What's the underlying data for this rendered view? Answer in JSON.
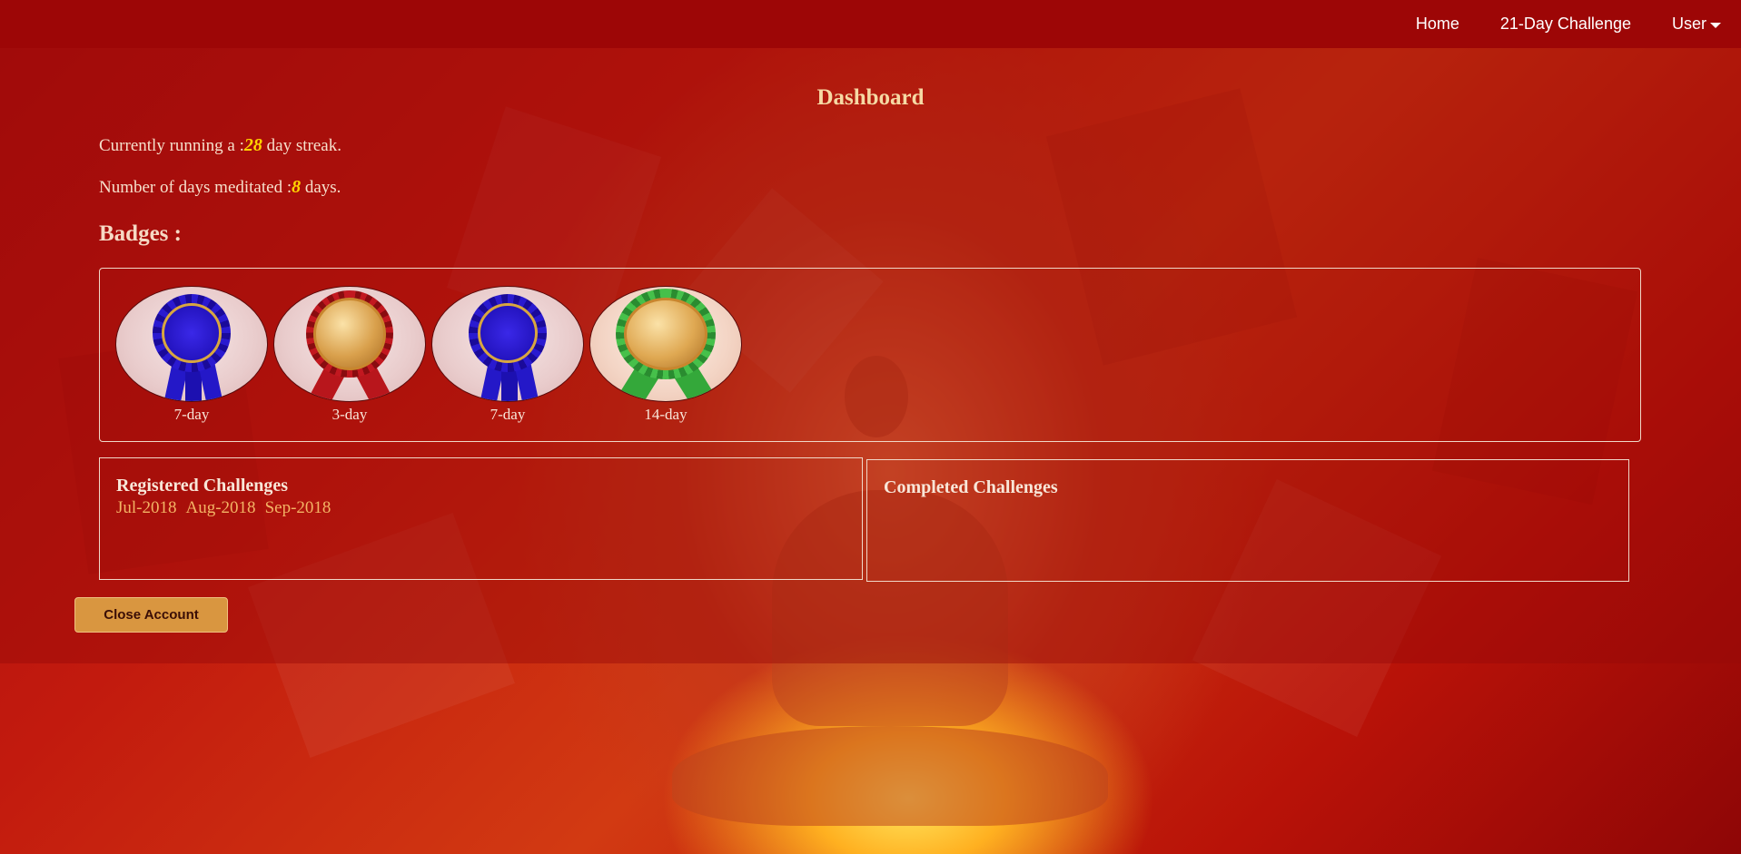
{
  "nav": {
    "home": "Home",
    "challenge": "21-Day Challenge",
    "user": "User"
  },
  "page": {
    "title": "Dashboard"
  },
  "stats": {
    "streak_prefix": "Currently running a :",
    "streak_value": "28",
    "streak_suffix": " day streak.",
    "days_prefix": "Number of days meditated :",
    "days_value": "8",
    "days_suffix": " days."
  },
  "badges": {
    "heading": "Badges :",
    "items": [
      {
        "label": "7-day",
        "style": "blue-rosette"
      },
      {
        "label": "3-day",
        "style": "gold-red-medal"
      },
      {
        "label": "7-day",
        "style": "blue-rosette"
      },
      {
        "label": "14-day",
        "style": "gold-green-medal"
      }
    ]
  },
  "registered": {
    "title": "Registered Challenges",
    "items": [
      "Jul-2018",
      "Aug-2018",
      "Sep-2018"
    ]
  },
  "completed": {
    "title": "Completed Challenges"
  },
  "actions": {
    "close_account": "Close Account"
  },
  "colors": {
    "navbar": "#9d0606",
    "accent_number": "#ffd400",
    "challenge_text": "#f3b465",
    "button": "#d99640"
  }
}
